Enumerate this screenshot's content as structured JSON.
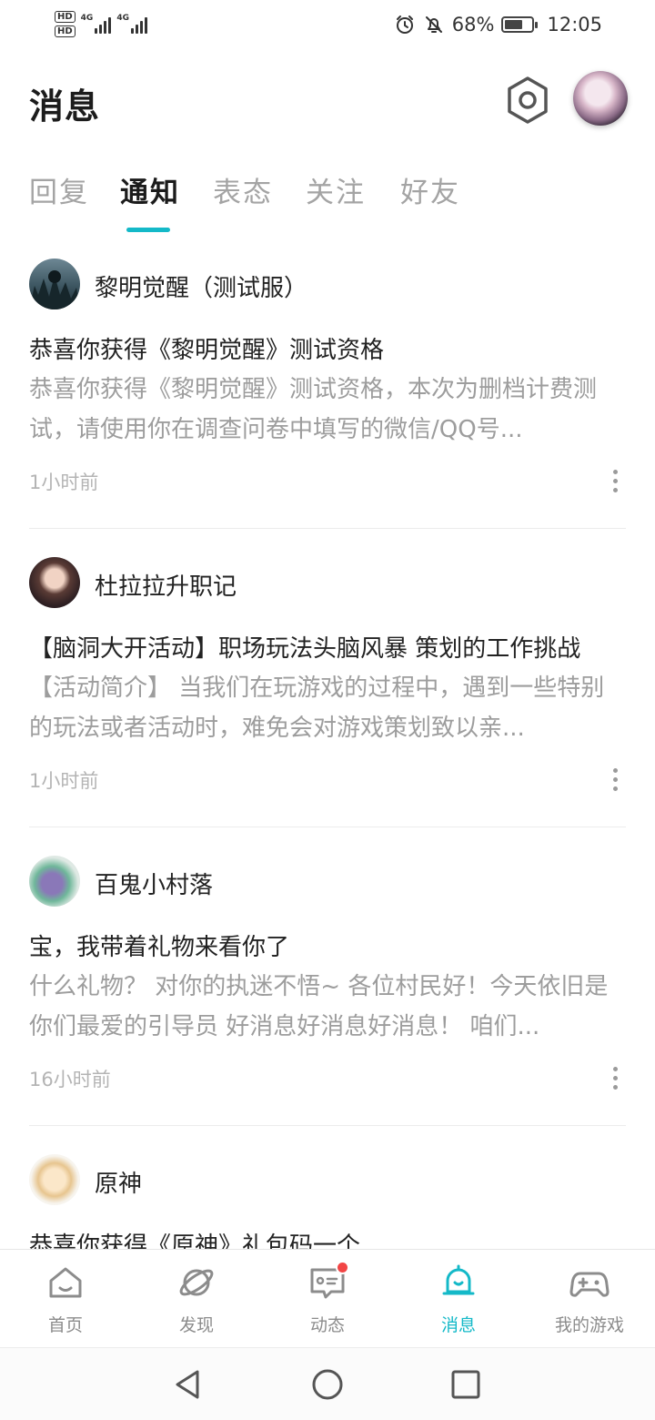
{
  "status_bar": {
    "hd_1": "HD",
    "hd_2": "HD",
    "net_1": "4G",
    "net_2": "4G",
    "battery_percent": "68%",
    "battery_level": 0.68,
    "time": "12:05"
  },
  "header": {
    "title": "消息",
    "settings_icon": "settings-hexagon-icon"
  },
  "tabs": [
    {
      "label": "回复",
      "active": false
    },
    {
      "label": "通知",
      "active": true
    },
    {
      "label": "表态",
      "active": false
    },
    {
      "label": "关注",
      "active": false
    },
    {
      "label": "好友",
      "active": false
    }
  ],
  "notifications": [
    {
      "sender": "黎明觉醒（测试服）",
      "title": "恭喜你获得《黎明觉醒》测试资格",
      "body": "恭喜你获得《黎明觉醒》测试资格，本次为删档计费测试，请使用你在调查问卷中填写的微信/QQ号...",
      "time": "1小时前"
    },
    {
      "sender": "杜拉拉升职记",
      "title": "【脑洞大开活动】职场玩法头脑风暴 策划的工作挑战",
      "body": "【活动简介】 当我们在玩游戏的过程中，遇到一些特别的玩法或者活动时，难免会对游戏策划致以亲...",
      "time": "1小时前"
    },
    {
      "sender": "百鬼小村落",
      "title": "宝，我带着礼物来看你了",
      "body": "什么礼物？ 对你的执迷不悟~ 各位村民好！今天依旧是你们最爱的引导员 好消息好消息好消息！ 咱们...",
      "time": "16小时前"
    },
    {
      "sender": "原神",
      "title": "恭喜你获得《原神》礼包码一个",
      "body": "",
      "time": ""
    }
  ],
  "bottom_nav": [
    {
      "label": "首页",
      "icon": "home-icon",
      "active": false
    },
    {
      "label": "发现",
      "icon": "planet-icon",
      "active": false
    },
    {
      "label": "动态",
      "icon": "message-card-icon",
      "active": false,
      "badge": true
    },
    {
      "label": "消息",
      "icon": "bell-icon",
      "active": true
    },
    {
      "label": "我的游戏",
      "icon": "gamepad-icon",
      "active": false
    }
  ],
  "colors": {
    "accent": "#14b9c8",
    "badge": "#f24545",
    "muted_text": "#9d9d9d"
  }
}
